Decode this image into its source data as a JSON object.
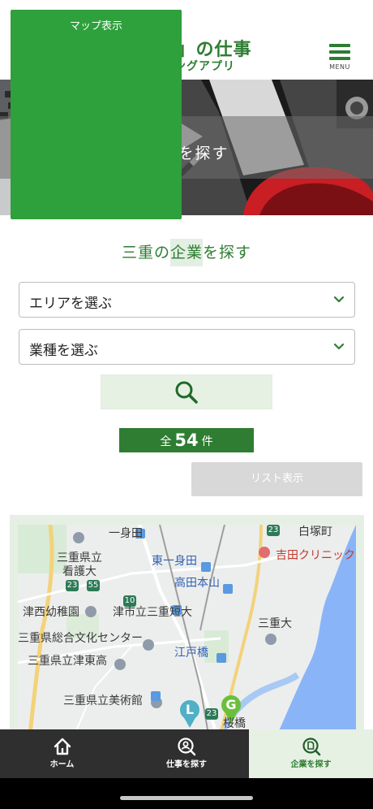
{
  "header": {
    "logo_line1": "「みえ」の仕事",
    "logo_line2": "マッチングアプリ",
    "menu_label": "MENU"
  },
  "hero": {
    "title": "企業を探す"
  },
  "search": {
    "title_prefix": "三重の",
    "title_highlight": "企業",
    "title_suffix": "を探す",
    "area_select": "エリアを選ぶ",
    "industry_select": "業種を選ぶ"
  },
  "results": {
    "prefix": "全",
    "count": "54",
    "suffix": "件"
  },
  "view_tabs": {
    "map": "マップ表示",
    "list": "リスト表示"
  },
  "map": {
    "labels": {
      "ichimida": "一身田",
      "higashi_ichimida": "東一身田",
      "mieken_kango_1": "三重県立",
      "mieken_kango_2": "看護大",
      "takada_honzan": "高田本山",
      "yoshida_clinic": "吉田クリニック",
      "tsu_nishi": "津西幼稚園",
      "tsu_shiritsu": "津市立三重短大",
      "mie_dai": "三重大",
      "sogo_bunka": "三重県総合文化センター",
      "edobashi": "江戸橋",
      "tsu_higashi": "三重県立津東高",
      "bijutsukan": "三重県立美術館",
      "shiozukacho": "白塚町",
      "kyobashi": "桜橋",
      "route_23a": "23",
      "route_23b": "23",
      "route_55": "55",
      "route_10": "10",
      "route_23c": "23",
      "pin_l": "L",
      "pin_g": "G"
    }
  },
  "nav": {
    "home": "ホーム",
    "jobs": "仕事を探す",
    "companies": "企業を探す"
  }
}
